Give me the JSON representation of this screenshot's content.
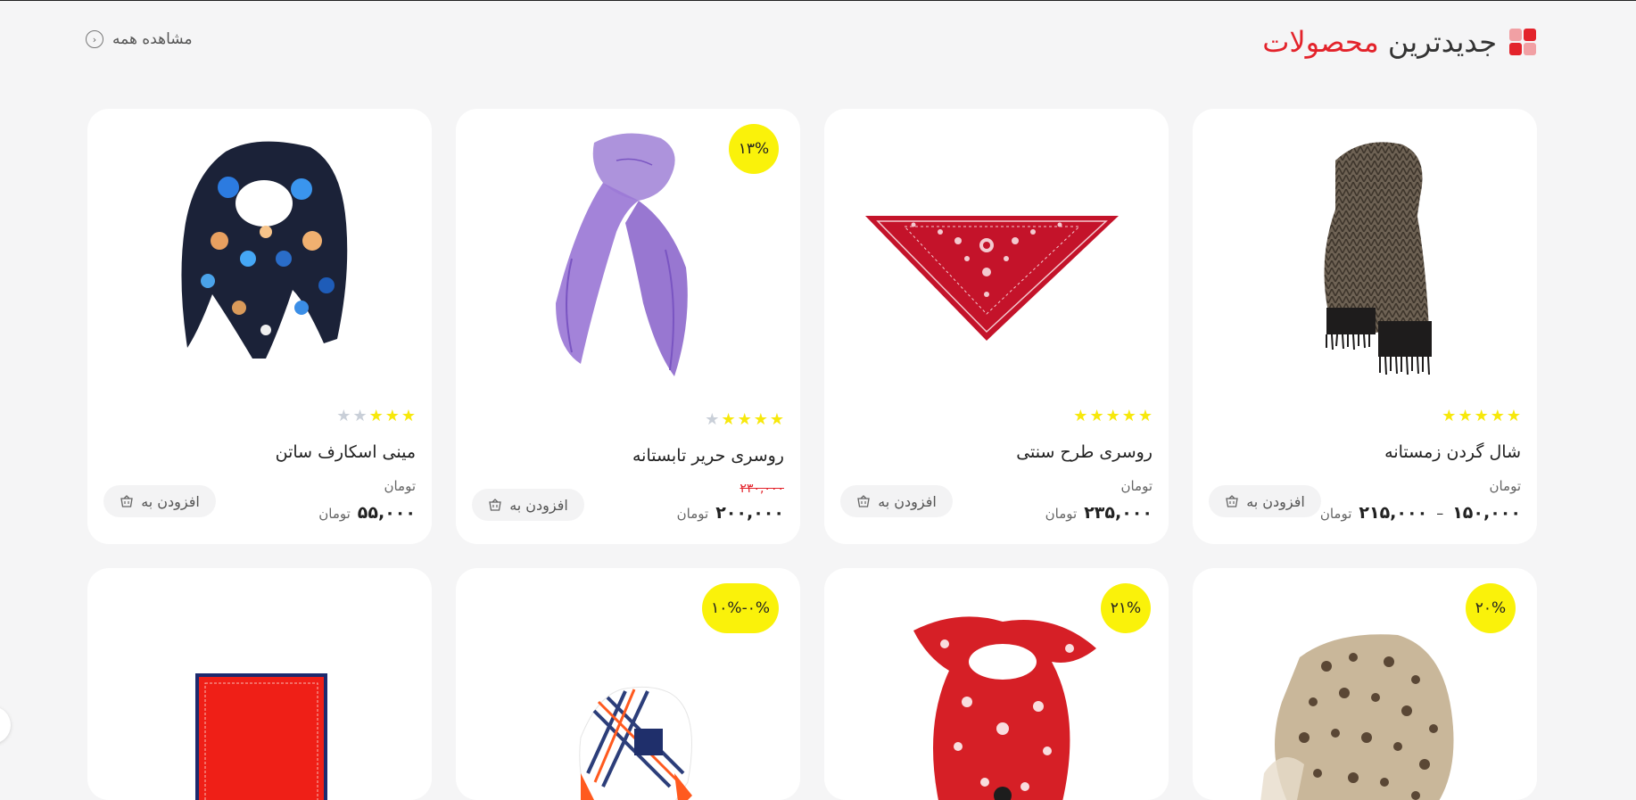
{
  "header": {
    "title_plain": "جدیدترین",
    "title_accent": "محصولات",
    "view_all": "مشاهده همه"
  },
  "colors": {
    "accent": "#e3232b",
    "badge": "#faf20a",
    "star_on": "#f7e80b",
    "star_off": "#c9cfd8"
  },
  "products": [
    {
      "name": "شال گردن زمستانه",
      "rating_stars": 5,
      "currency_label": "تومان",
      "price_min": "۱۵۰,۰۰۰",
      "price_max": "۲۱۵,۰۰۰",
      "price_separator": "–",
      "price_currency": "تومان",
      "add_label": "افزودن به"
    },
    {
      "name": "روسری طرح سنتی",
      "rating_stars": 5,
      "currency_label": "تومان",
      "price": "۲۳۵,۰۰۰",
      "price_currency": "تومان",
      "add_label": "افزودن به"
    },
    {
      "name": "روسری حریر تابستانه",
      "badge": "۱۳%",
      "rating_stars": 4,
      "old_price": "۲۳۰,۰۰۰",
      "price": "۲۰۰,۰۰۰",
      "price_currency": "تومان",
      "add_label": "افزودن به"
    },
    {
      "name": "مینی اسکارف ساتن",
      "rating_stars": 3,
      "currency_label": "تومان",
      "price": "۵۵,۰۰۰",
      "price_currency": "تومان",
      "add_label": "افزودن به"
    }
  ],
  "row2": [
    {
      "badge": "۲۰%"
    },
    {
      "badge": "۲۱%"
    },
    {
      "badge": "۱۰%-۰%"
    },
    {}
  ]
}
